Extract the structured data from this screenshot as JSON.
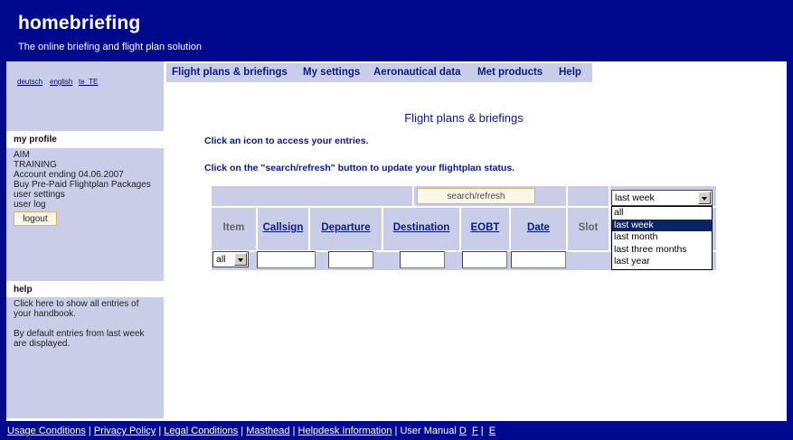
{
  "header": {
    "title": "homebriefing",
    "subtitle": "The online briefing and flight plan solution"
  },
  "languages": [
    "deutsch",
    "english",
    "te_TE"
  ],
  "nav": {
    "tabs": [
      "Flight plans & briefings",
      "My settings",
      "Aeronautical data",
      "Met products",
      "Help"
    ]
  },
  "profile": {
    "heading": "my profile",
    "lines": [
      "AIM",
      "TRAINING",
      "Account ending 04.06.2007"
    ],
    "links": [
      "Buy Pre-Paid Flightplan Packages",
      "user settings",
      "user log"
    ],
    "logout_label": "logout"
  },
  "help": {
    "heading": "help",
    "paragraphs": [
      "Click here to show all entries of your handbook.",
      "By default entries from last week are displayed."
    ]
  },
  "main": {
    "title": "Flight plans & briefings",
    "instruction1": "Click an icon to access your entries.",
    "instruction2": "Click on the \"search/refresh\" button to update your flightplan status.",
    "search_label": "search/refresh",
    "period_selected": "last week",
    "period_options": [
      "all",
      "last week",
      "last month",
      "last three months",
      "last year"
    ],
    "item_filter_value": "all",
    "columns": [
      "Item",
      "Callsign",
      "Departure",
      "Destination",
      "EOBT",
      "Date",
      "Slot"
    ]
  },
  "footer": {
    "links": [
      "Usage Conditions",
      "Privacy Policy",
      "Legal Conditions",
      "Masthead",
      "Helpdesk Information"
    ],
    "manual_label": "User Manual",
    "manual_langs": [
      "D",
      "F",
      "E"
    ]
  },
  "colors": {
    "brand_blue": "#00098e",
    "panel_lavender": "#c9cee8",
    "button_border": "#e0b070"
  }
}
